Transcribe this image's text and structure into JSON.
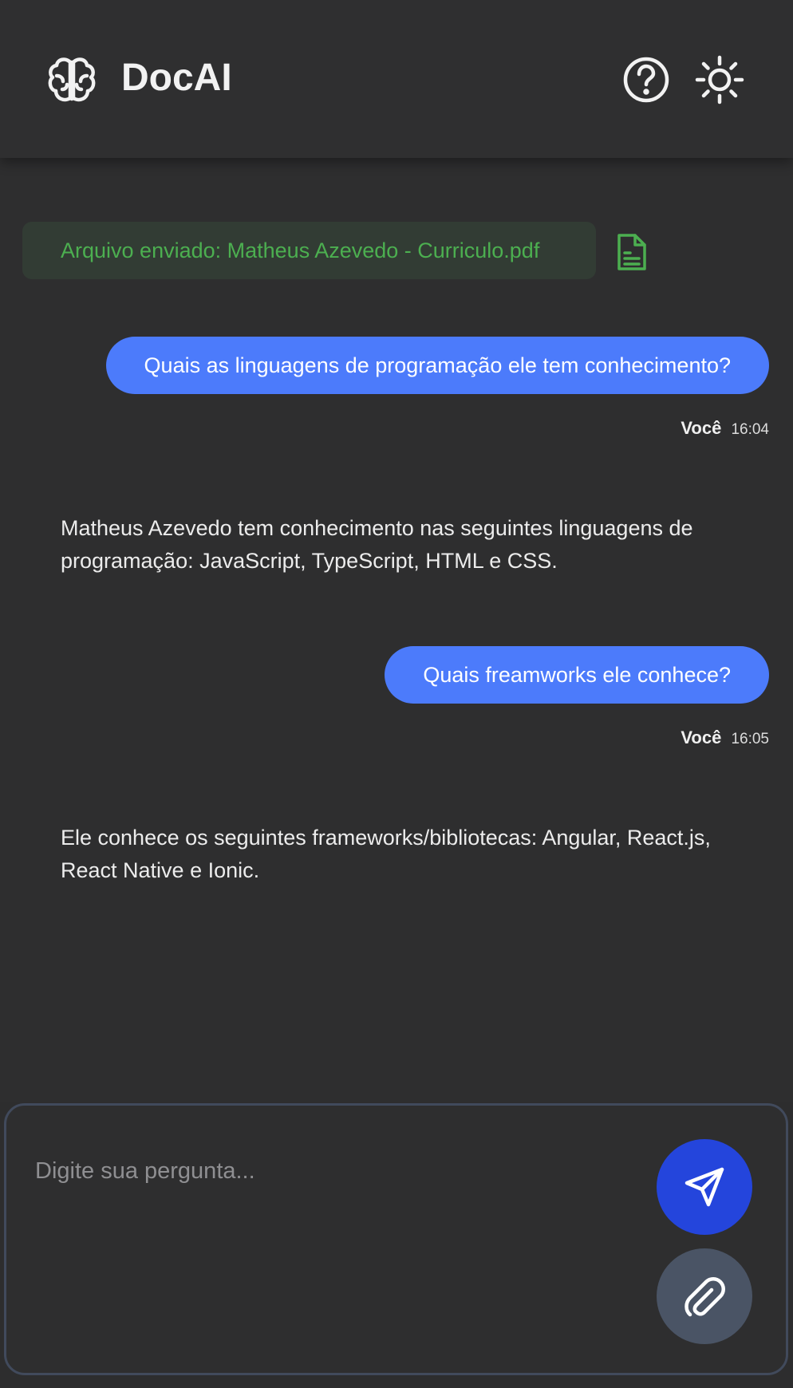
{
  "app": {
    "title": "DocAI"
  },
  "header": {
    "icons": {
      "brand": "brain-icon",
      "help": "help-circle-icon",
      "theme": "sun-icon"
    }
  },
  "colors": {
    "user_bubble": "#4c7bfb",
    "file_chip_text": "#4caf50",
    "send_button": "#2445dc",
    "attach_button": "#4a5465"
  },
  "chat": {
    "file": {
      "label": "Arquivo enviado: Matheus Azevedo - Curriculo.pdf",
      "icon": "document-icon"
    },
    "messages": [
      {
        "role": "user",
        "text": "Quais as linguagens de programação ele tem conhecimento?",
        "author": "Você",
        "time": "16:04"
      },
      {
        "role": "assistant",
        "text": "Matheus Azevedo tem conhecimento nas seguintes linguagens de programação: JavaScript, TypeScript, HTML e CSS."
      },
      {
        "role": "user",
        "text": "Quais freamworks ele conhece?",
        "author": "Você",
        "time": "16:05"
      },
      {
        "role": "assistant",
        "text": "Ele conhece os seguintes frameworks/bibliotecas: Angular, React.js, React Native e Ionic."
      }
    ]
  },
  "composer": {
    "placeholder": "Digite sua pergunta...",
    "value": "",
    "send_icon": "send-icon",
    "attach_icon": "paperclip-icon"
  }
}
